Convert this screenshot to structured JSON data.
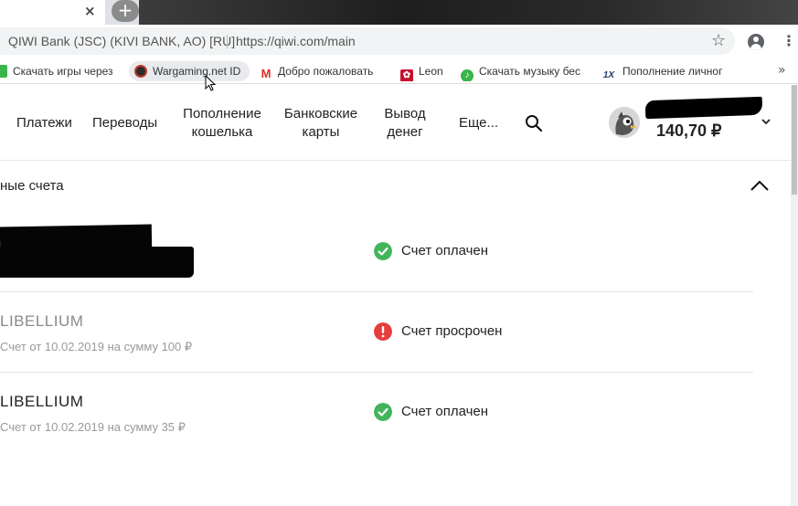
{
  "browser": {
    "tab_close_glyph": "×",
    "new_tab_glyph": "+",
    "site_identity": "QIWI Bank (JSC) (KIVI BANK, AO) [RU]",
    "url": "https://qiwi.com/main",
    "star_glyph": "☆",
    "menu_glyph": "⋮",
    "more_bookmarks_glyph": "»",
    "bookmarks": [
      {
        "label": "Скачать игры через",
        "icon": "green-square-icon"
      },
      {
        "label": "Wargaming.net ID",
        "icon": "wargaming-icon"
      },
      {
        "label": "Добро пожаловать",
        "icon": "gmail-icon"
      },
      {
        "label": "Leon",
        "icon": "leon-icon"
      },
      {
        "label": "Скачать музыку бес",
        "icon": "music-icon"
      },
      {
        "label": "Пополнение личног",
        "icon": "1x-icon"
      }
    ]
  },
  "header": {
    "nav": [
      {
        "label": "Платежи"
      },
      {
        "label": "Переводы"
      },
      {
        "label": "Пополнение кошелька"
      },
      {
        "label": "Банковские карты"
      },
      {
        "label": "Вывод денег"
      },
      {
        "label": "Еще..."
      }
    ],
    "balance": "140,70 ₽"
  },
  "section": {
    "title": "ные счета"
  },
  "invoices": [
    {
      "merchant": "",
      "description": "",
      "status": "Счет оплачен",
      "status_type": "paid"
    },
    {
      "merchant": "LIBELLIUM",
      "description": "Счет от 10.02.2019 на сумму 100 ₽",
      "status": "Счет просрочен",
      "status_type": "expired"
    },
    {
      "merchant": "LIBELLIUM",
      "description": "Счет от 10.02.2019 на сумму 35 ₽",
      "status": "Счет оплачен",
      "status_type": "paid"
    }
  ],
  "colors": {
    "paid": "#43b45b",
    "expired": "#e63d3d",
    "text_muted": "#9a9a9a"
  }
}
